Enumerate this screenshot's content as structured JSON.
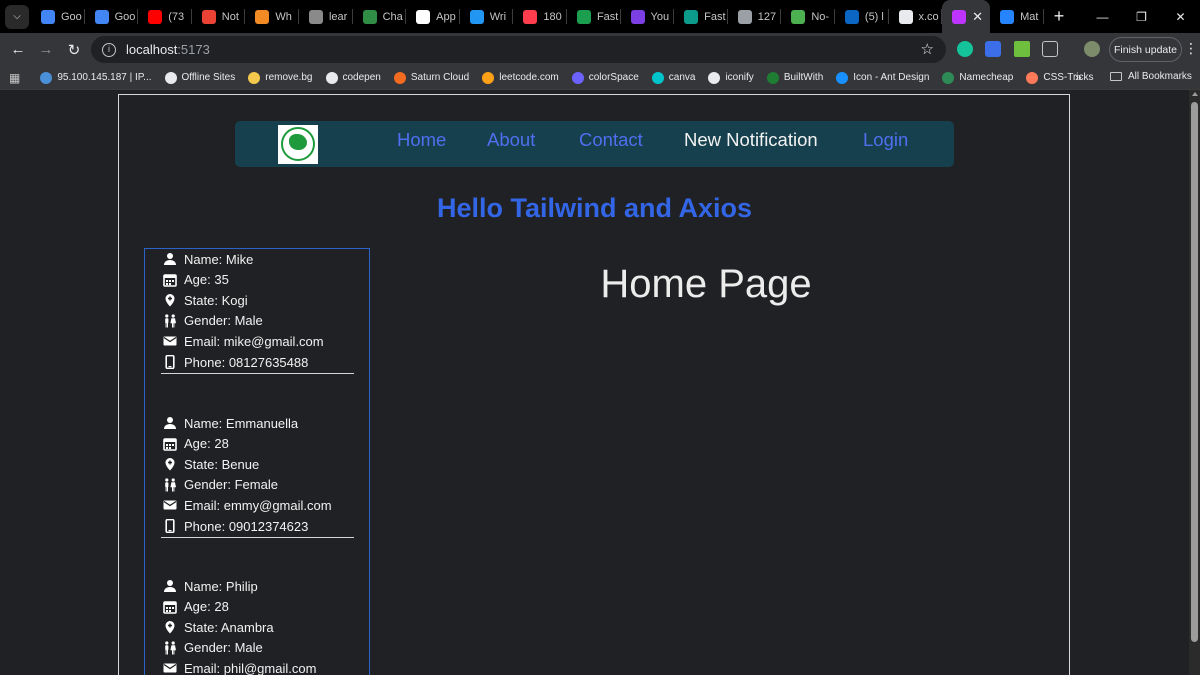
{
  "browser": {
    "tabs": [
      {
        "label": "Goo",
        "color": "#4285f4"
      },
      {
        "label": "Goo",
        "color": "#4285f4"
      },
      {
        "label": "(73",
        "color": "#ff0000"
      },
      {
        "label": "Not",
        "color": "#ea4335"
      },
      {
        "label": "Wh",
        "color": "#f28b24"
      },
      {
        "label": "lear",
        "color": "#8a8a8a"
      },
      {
        "label": "Cha",
        "color": "#2f8d46"
      },
      {
        "label": "App",
        "color": "#ffffff"
      },
      {
        "label": "Wri",
        "color": "#2196f3"
      },
      {
        "label": "180",
        "color": "#ff3d4d"
      },
      {
        "label": "Fast",
        "color": "#1b9f4f"
      },
      {
        "label": "You",
        "color": "#7b3fe4"
      },
      {
        "label": "Fast",
        "color": "#0c9a8a"
      },
      {
        "label": "127",
        "color": "#9aa0a6"
      },
      {
        "label": "No-",
        "color": "#4caf50"
      },
      {
        "label": "(5) l",
        "color": "#0a66c2"
      },
      {
        "label": "x.co",
        "color": "#e8eaed"
      },
      {
        "label": "Mat",
        "color": "#2684ff"
      }
    ],
    "active_tab": {
      "label": "",
      "color": "#bd34fe"
    },
    "new_tab_label": "+",
    "address": {
      "host": "localhost",
      "port": ":5173"
    },
    "finish_update_label": "Finish update",
    "bookmarks": [
      {
        "label": "95.100.145.187 | IP...",
        "color": "#4a90d9"
      },
      {
        "label": "Offline Sites",
        "color": "#e8eaed"
      },
      {
        "label": "remove.bg",
        "color": "#f2c94c"
      },
      {
        "label": "codepen",
        "color": "#e8eaed"
      },
      {
        "label": "Saturn Cloud",
        "color": "#f26b21"
      },
      {
        "label": "leetcode.com",
        "color": "#ffa116"
      },
      {
        "label": "colorSpace",
        "color": "#6c63ff"
      },
      {
        "label": "canva",
        "color": "#00c4cc"
      },
      {
        "label": "iconify",
        "color": "#e8eaed"
      },
      {
        "label": "BuiltWith",
        "color": "#1e7d32"
      },
      {
        "label": "Icon - Ant Design",
        "color": "#1890ff"
      },
      {
        "label": "Namecheap",
        "color": "#2e8b57"
      },
      {
        "label": "CSS-Tricks",
        "color": "#ff7a59"
      }
    ],
    "bookmarks_more": "»",
    "all_bookmarks_label": "All Bookmarks"
  },
  "app": {
    "nav": {
      "home": "Home",
      "about": "About",
      "contact": "Contact",
      "notification": "New Notification",
      "login": "Login"
    },
    "heading": "Hello Tailwind and Axios",
    "page_title": "Home Page",
    "users": [
      {
        "name": "Name: Mike",
        "age": "Age: 35",
        "state": "State: Kogi",
        "gender": "Gender: Male",
        "email": "Email: mike@gmail.com",
        "phone": "Phone: 08127635488"
      },
      {
        "name": "Name: Emmanuella",
        "age": "Age: 28",
        "state": "State: Benue",
        "gender": "Gender: Female",
        "email": "Email: emmy@gmail.com",
        "phone": "Phone: 09012374623"
      },
      {
        "name": "Name: Philip",
        "age": "Age: 28",
        "state": "State: Anambra",
        "gender": "Gender: Male",
        "email": "Email: phil@gmail.com"
      }
    ]
  }
}
